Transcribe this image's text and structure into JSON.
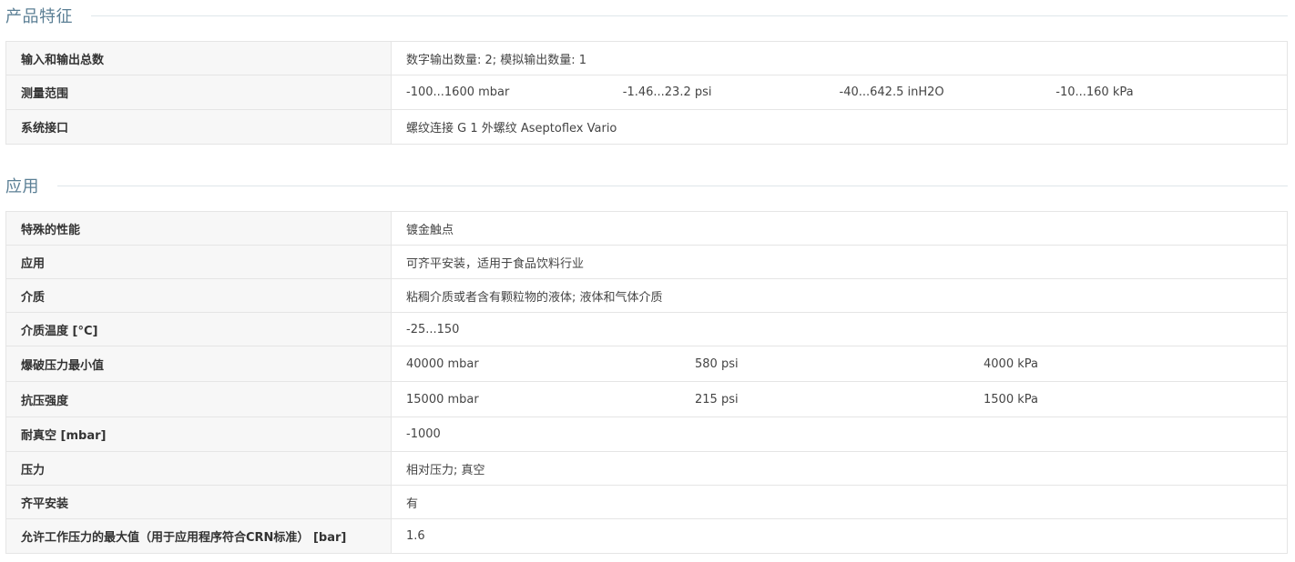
{
  "features": {
    "title": "产品特征",
    "rows": [
      {
        "label": "输入和输出总数",
        "value": "数字输出数量: 2; 模拟输出数量: 1"
      },
      {
        "label": "测量范围",
        "values": [
          "-100...1600 mbar",
          "-1.46...23.2 psi",
          "-40...642.5 inH2O",
          "-10...160 kPa"
        ]
      },
      {
        "label": "系统接口",
        "value": "螺纹连接 G 1 外螺纹 Aseptoflex Vario"
      }
    ]
  },
  "application": {
    "title": "应用",
    "rows": [
      {
        "label": "特殊的性能",
        "value": "镀金触点"
      },
      {
        "label": "应用",
        "value": "可齐平安装，适用于食品饮料行业"
      },
      {
        "label": "介质",
        "value": "粘稠介质或者含有颗粒物的液体; 液体和气体介质"
      },
      {
        "label": "介质温度 [°C]",
        "value": "-25...150"
      },
      {
        "label": "爆破压力最小值",
        "values": [
          "40000 mbar",
          "580 psi",
          "4000 kPa"
        ]
      },
      {
        "label": "抗压强度",
        "values": [
          "15000 mbar",
          "215 psi",
          "1500 kPa"
        ]
      },
      {
        "label": "耐真空 [mbar]",
        "value": "-1000"
      },
      {
        "label": "压力",
        "value": "相对压力; 真空"
      },
      {
        "label": "齐平安装",
        "value": "有"
      },
      {
        "label": "允许工作压力的最大值（用于应用程序符合CRN标准） [bar]",
        "value": "1.6"
      }
    ]
  }
}
